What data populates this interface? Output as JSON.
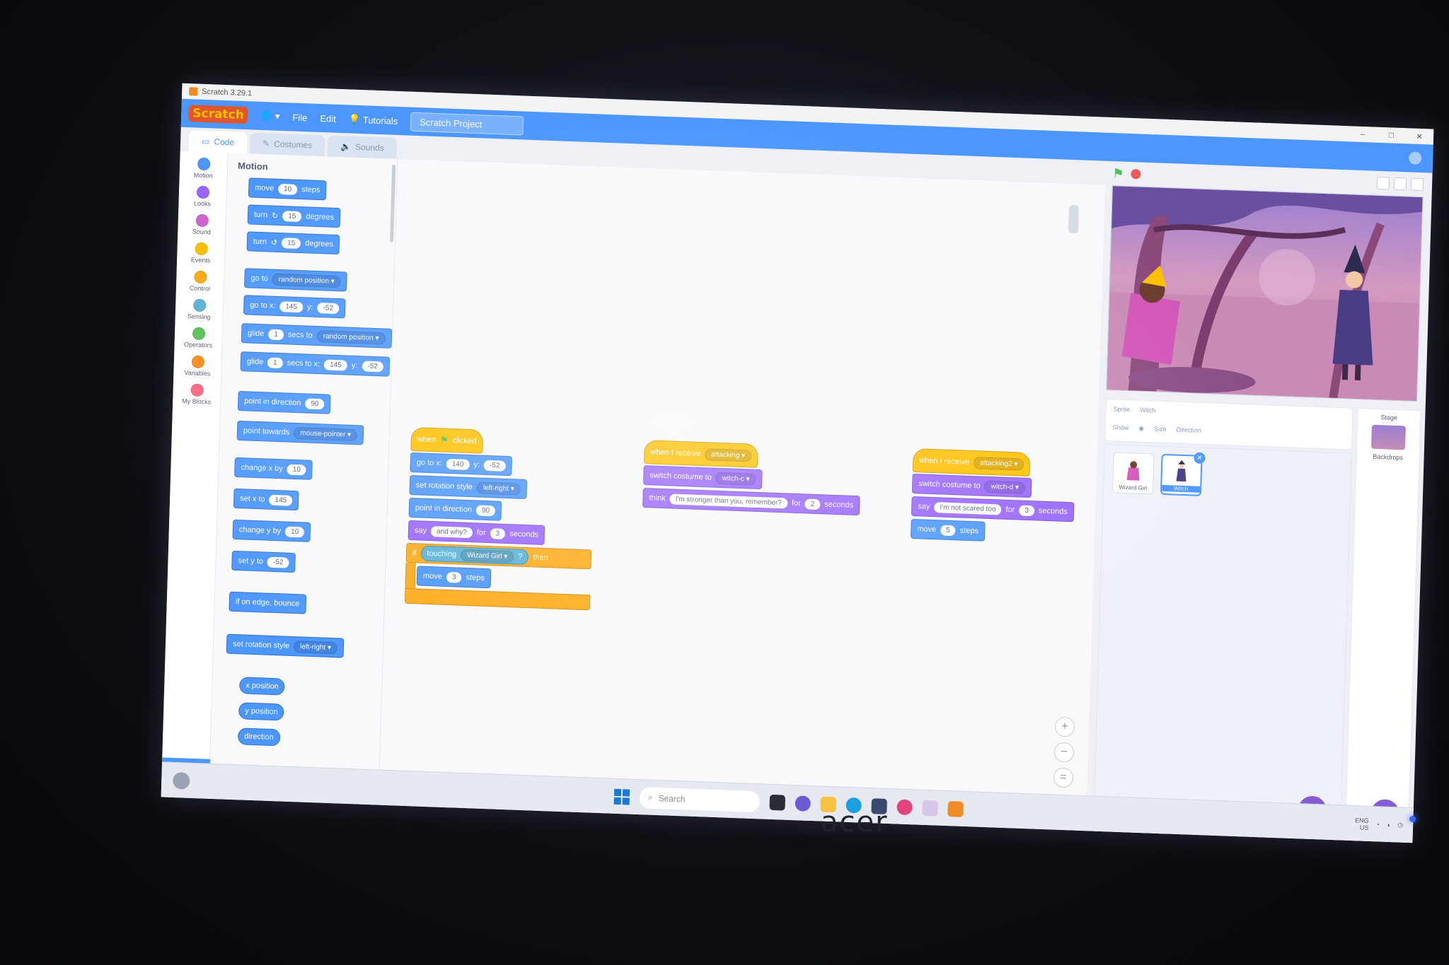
{
  "window": {
    "title": "Scratch 3.29.1",
    "controls": [
      "–",
      "□",
      "✕"
    ]
  },
  "menubar": {
    "logo": "Scratch",
    "items": [
      {
        "label": "File"
      },
      {
        "label": "Edit"
      },
      {
        "label": "Tutorials"
      }
    ],
    "project_title": "Scratch Project"
  },
  "tabs": [
    {
      "label": "Code",
      "icon": "code-icon",
      "active": true
    },
    {
      "label": "Costumes",
      "icon": "brush-icon",
      "active": false
    },
    {
      "label": "Sounds",
      "icon": "speaker-icon",
      "active": false
    }
  ],
  "categories": [
    {
      "label": "Motion",
      "color": "#4c97ff"
    },
    {
      "label": "Looks",
      "color": "#9966ff"
    },
    {
      "label": "Sound",
      "color": "#cf63cf"
    },
    {
      "label": "Events",
      "color": "#ffbf00"
    },
    {
      "label": "Control",
      "color": "#ffab19"
    },
    {
      "label": "Sensing",
      "color": "#5cb1d6"
    },
    {
      "label": "Operators",
      "color": "#59c059"
    },
    {
      "label": "Variables",
      "color": "#ff8c1a"
    },
    {
      "label": "My Blocks",
      "color": "#ff6680"
    }
  ],
  "palette": {
    "heading": "Motion",
    "blocks": {
      "move": {
        "label": "move",
        "value": "10",
        "suffix": "steps"
      },
      "turn_right": {
        "label": "turn",
        "glyph": "↻",
        "value": "15",
        "suffix": "degrees"
      },
      "turn_left": {
        "label": "turn",
        "glyph": "↺",
        "value": "15",
        "suffix": "degrees"
      },
      "go_to": {
        "label": "go to",
        "option": "random position ▾"
      },
      "go_to_xy": {
        "label": "go to x:",
        "x": "145",
        "y_label": "y:",
        "y": "-52"
      },
      "glide_to": {
        "label": "glide",
        "secs": "1",
        "mid": "secs to",
        "option": "random position ▾"
      },
      "glide_xy": {
        "label": "glide",
        "secs": "1",
        "mid": "secs to x:",
        "x": "145",
        "y_label": "y:",
        "y": "-52"
      },
      "point_direction": {
        "label": "point in direction",
        "value": "90"
      },
      "point_towards": {
        "label": "point towards",
        "option": "mouse-pointer ▾"
      },
      "change_x": {
        "label": "change x by",
        "value": "10"
      },
      "set_x": {
        "label": "set x to",
        "value": "145"
      },
      "change_y": {
        "label": "change y by",
        "value": "10"
      },
      "set_y": {
        "label": "set y to",
        "value": "-52"
      },
      "bounce": {
        "label": "if on edge, bounce"
      },
      "rotation_style": {
        "label": "set rotation style",
        "option": "left-right ▾"
      },
      "x_position": {
        "label": "x position"
      },
      "y_position": {
        "label": "y position"
      },
      "direction": {
        "label": "direction"
      }
    }
  },
  "scripts": {
    "script1": {
      "hat": {
        "label": "when",
        "flag": "⚑",
        "suffix": "clicked"
      },
      "goto": {
        "label": "go to x:",
        "x": "140",
        "y_label": "y:",
        "y": "-52"
      },
      "rotation": {
        "label": "set rotation style",
        "option": "left-right ▾"
      },
      "direction": {
        "label": "point in direction",
        "value": "90"
      },
      "say": {
        "label": "say",
        "text": "and why?",
        "for": "for",
        "secs": "3",
        "suffix": "seconds"
      },
      "if": {
        "label": "if",
        "sensing_label": "touching",
        "sensing_option": "Wizard Girl ▾",
        "q": "?",
        "then": "then"
      },
      "inner_move": {
        "label": "move",
        "value": "3",
        "suffix": "steps"
      }
    },
    "script2": {
      "hat": {
        "label": "when I receive",
        "option": "attacking ▾"
      },
      "costume": {
        "label": "switch costume to",
        "option": "witch-c ▾"
      },
      "think": {
        "label": "think",
        "text": "I'm stronger than you, remember?",
        "for": "for",
        "secs": "2",
        "suffix": "seconds"
      }
    },
    "script3": {
      "hat": {
        "label": "when I receive",
        "option": "attacking2 ▾"
      },
      "costume": {
        "label": "switch costume to",
        "option": "witch-d ▾"
      },
      "say": {
        "label": "say",
        "text": "I'm not scared too",
        "for": "for",
        "secs": "3",
        "suffix": "seconds"
      },
      "move": {
        "label": "move",
        "value": "5",
        "suffix": "steps"
      }
    }
  },
  "stage": {
    "sprites": [
      {
        "name": "Wizard Girl",
        "selected": false
      },
      {
        "name": "Witch",
        "selected": true
      }
    ],
    "info": {
      "sprite_label": "Sprite",
      "sprite_name": "Witch",
      "show_label": "Show",
      "size_label": "Size",
      "direction_label": "Direction"
    },
    "stage_pane": {
      "label": "Stage",
      "backdrops_label": "Backdrops"
    }
  },
  "taskbar": {
    "search_placeholder": "Search",
    "lang": "ENG",
    "region": "US"
  },
  "monitor": {
    "brand": "acer"
  }
}
